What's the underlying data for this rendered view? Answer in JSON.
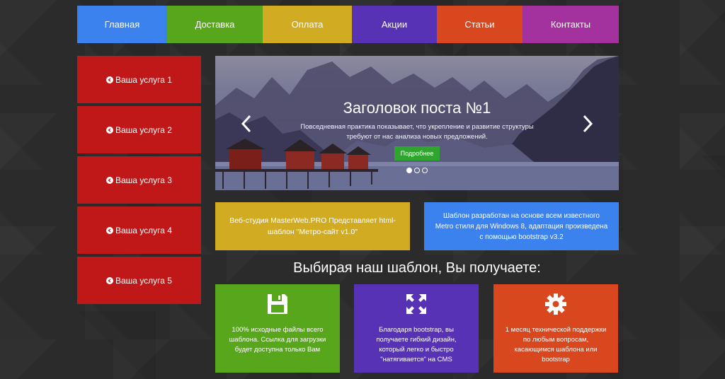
{
  "nav": {
    "items": [
      {
        "label": "Главная",
        "color": "#3b82ee"
      },
      {
        "label": "Доставка",
        "color": "#58a61c"
      },
      {
        "label": "Оплата",
        "color": "#d1ac22"
      },
      {
        "label": "Акции",
        "color": "#5732b4"
      },
      {
        "label": "Статьи",
        "color": "#d9471e"
      },
      {
        "label": "Контакты",
        "color": "#a4329e"
      }
    ]
  },
  "sidebar": {
    "items": [
      {
        "label": "Ваша услуга 1"
      },
      {
        "label": "Ваша услуга 2"
      },
      {
        "label": "Ваша услуга 3"
      },
      {
        "label": "Ваша услуга 4"
      },
      {
        "label": "Ваша услуга 5"
      }
    ]
  },
  "slider": {
    "title": "Заголовок поста №1",
    "text": "Повседневная практика показывает, что укрепление и развитие структуры требуют от нас анализа новых предложений.",
    "button_label": "Подробнее",
    "slide_count": 3,
    "active_slide": 1
  },
  "info": {
    "left": "Веб-студия MasterWeb.PRO Представляет html-шаблон \"Метро-сайт v1.0\"",
    "right": "Шаблон разработан на основе всем известного Metro стиля для Windows 8, адаптация произведена с помощью bootstrap v3.2"
  },
  "features": {
    "heading": "Выбирая наш шаблон, Вы получаете:",
    "items": [
      {
        "icon": "floppy-disk-icon",
        "color": "#58a61c",
        "text": "100% исходные файлы всего шаблона. Ссылка для загрузки будет доступна только Вам"
      },
      {
        "icon": "expand-icon",
        "color": "#5732b4",
        "text": "Благодаря bootstrap, вы получаете гибкий дизайн, который легко и быстро \"натягивается\" на CMS"
      },
      {
        "icon": "gear-icon",
        "color": "#d9471e",
        "text": "1 месяц технической поддержки по любым вопросам, касающимся шаблона или bootstrap"
      }
    ]
  }
}
